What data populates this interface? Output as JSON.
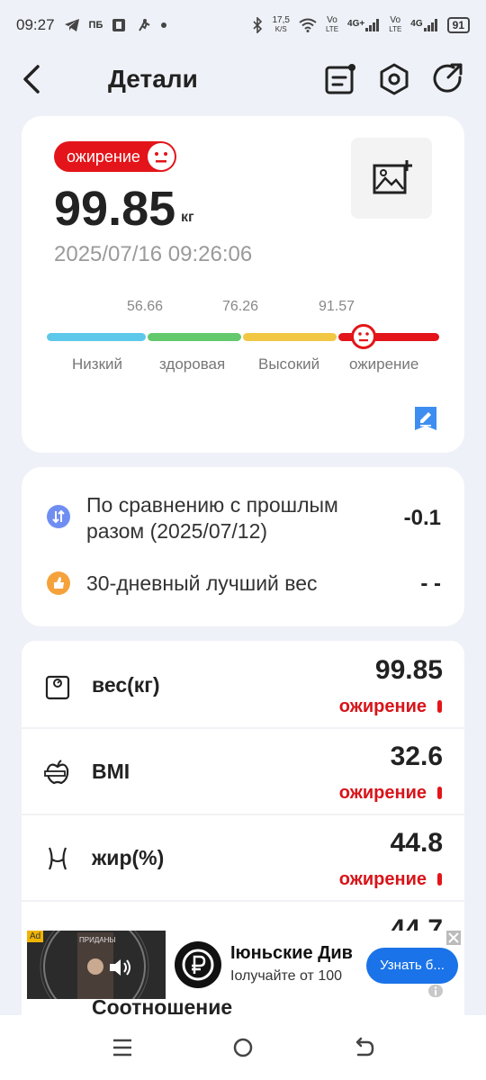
{
  "statusbar": {
    "time": "09:27",
    "left_icons": [
      "telegram-icon",
      "pb-icon",
      "app-icon",
      "activity-icon",
      "dot"
    ],
    "pb_label": "ПБ",
    "speed_value": "17,5",
    "speed_unit": "K/S",
    "signal1_label": "Vo",
    "signal1_sub": "LTE",
    "net1": "4G+",
    "signal2_label": "Vo",
    "signal2_sub": "LTE",
    "net2": "4G",
    "battery": "91"
  },
  "header": {
    "title": "Детали",
    "icons": [
      "back-icon",
      "report-icon",
      "settings-icon",
      "share-icon"
    ]
  },
  "summary": {
    "status_label": "ожирение",
    "weight": "99.85",
    "unit": "кг",
    "datetime": "2025/07/16 09:26:06",
    "scale": {
      "thresholds": [
        "56.66",
        "76.26",
        "91.57"
      ],
      "categories": [
        "Низкий",
        "здоровая",
        "Высокий",
        "ожирение"
      ],
      "colors": [
        "#5ec8ea",
        "#63c96c",
        "#f2c744",
        "#e3151a"
      ],
      "current_category_index": 3
    }
  },
  "comparison": {
    "items": [
      {
        "label_line1": "По сравнению с прошлым",
        "label_line2": "разом (2025/07/12)",
        "value": "-0.1",
        "icon": "compare-icon",
        "color": "#6f8ef2"
      },
      {
        "label_line1": "30-дневный лучший вес",
        "value": "- -",
        "icon": "thumbs-up-icon",
        "color": "#f5a23c"
      }
    ]
  },
  "metrics": [
    {
      "label": "вес(кг)",
      "value": "99.85",
      "status": "ожирение",
      "icon": "scale-icon"
    },
    {
      "label": "BMI",
      "value": "32.6",
      "status": "ожирение",
      "icon": "apple-tape-icon"
    },
    {
      "label": "жир(%)",
      "value": "44.8",
      "status": "ожирение",
      "icon": "waist-icon"
    }
  ],
  "peek": {
    "value": "44.7",
    "label": "Соотношение"
  },
  "ad": {
    "badge": "Ad",
    "film_text": "ПРИДАНЫ",
    "title": "Іюньские Див",
    "subtitle": "Іолучайте от 100",
    "cta": "Узнать б..."
  },
  "navbar": {
    "icons": [
      "menu-icon",
      "home-icon",
      "back-nav-icon"
    ]
  }
}
